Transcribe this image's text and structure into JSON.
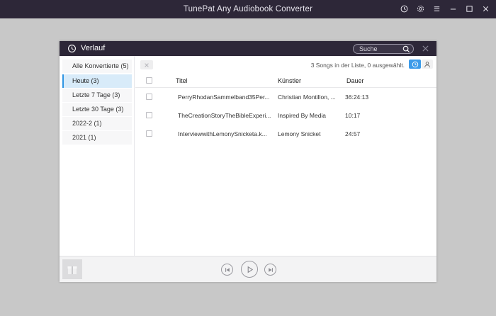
{
  "app": {
    "title": "TunePat Any Audiobook Converter"
  },
  "dialog": {
    "title": "Verlauf",
    "search_placeholder": "Suche"
  },
  "sidebar": {
    "items": [
      {
        "label": "Alle Konvertierte (5)"
      },
      {
        "label": "Heute (3)"
      },
      {
        "label": "Letzte 7 Tage (3)"
      },
      {
        "label": "Letzte 30 Tage (3)"
      },
      {
        "label": "2022-2 (1)"
      },
      {
        "label": "2021 (1)"
      }
    ],
    "active_index": 1
  },
  "list": {
    "count_text": "3 Songs in der Liste, 0 ausgewählt.",
    "columns": {
      "title": "Titel",
      "artist": "Künstler",
      "duration": "Dauer"
    },
    "rows": [
      {
        "title": "PerryRhodanSammelband35Per...",
        "artist": "Christian Montillon, ...",
        "duration": "36:24:13"
      },
      {
        "title": "TheCreationStoryTheBibleExperi...",
        "artist": "Inspired By Media",
        "duration": "10:17"
      },
      {
        "title": "InterviewwithLemonySnicketa.k...",
        "artist": "Lemony Snicket",
        "duration": "24:57"
      }
    ]
  },
  "icons": {
    "history": "clock-history-icon",
    "settings": "gear-icon",
    "menu": "menu-icon",
    "minimize": "minimize-icon",
    "maximize": "maximize-icon",
    "close": "close-icon"
  },
  "colors": {
    "titlebar": "#2d2738",
    "accent": "#3d9be9",
    "active_bg": "#d8ebf9"
  }
}
